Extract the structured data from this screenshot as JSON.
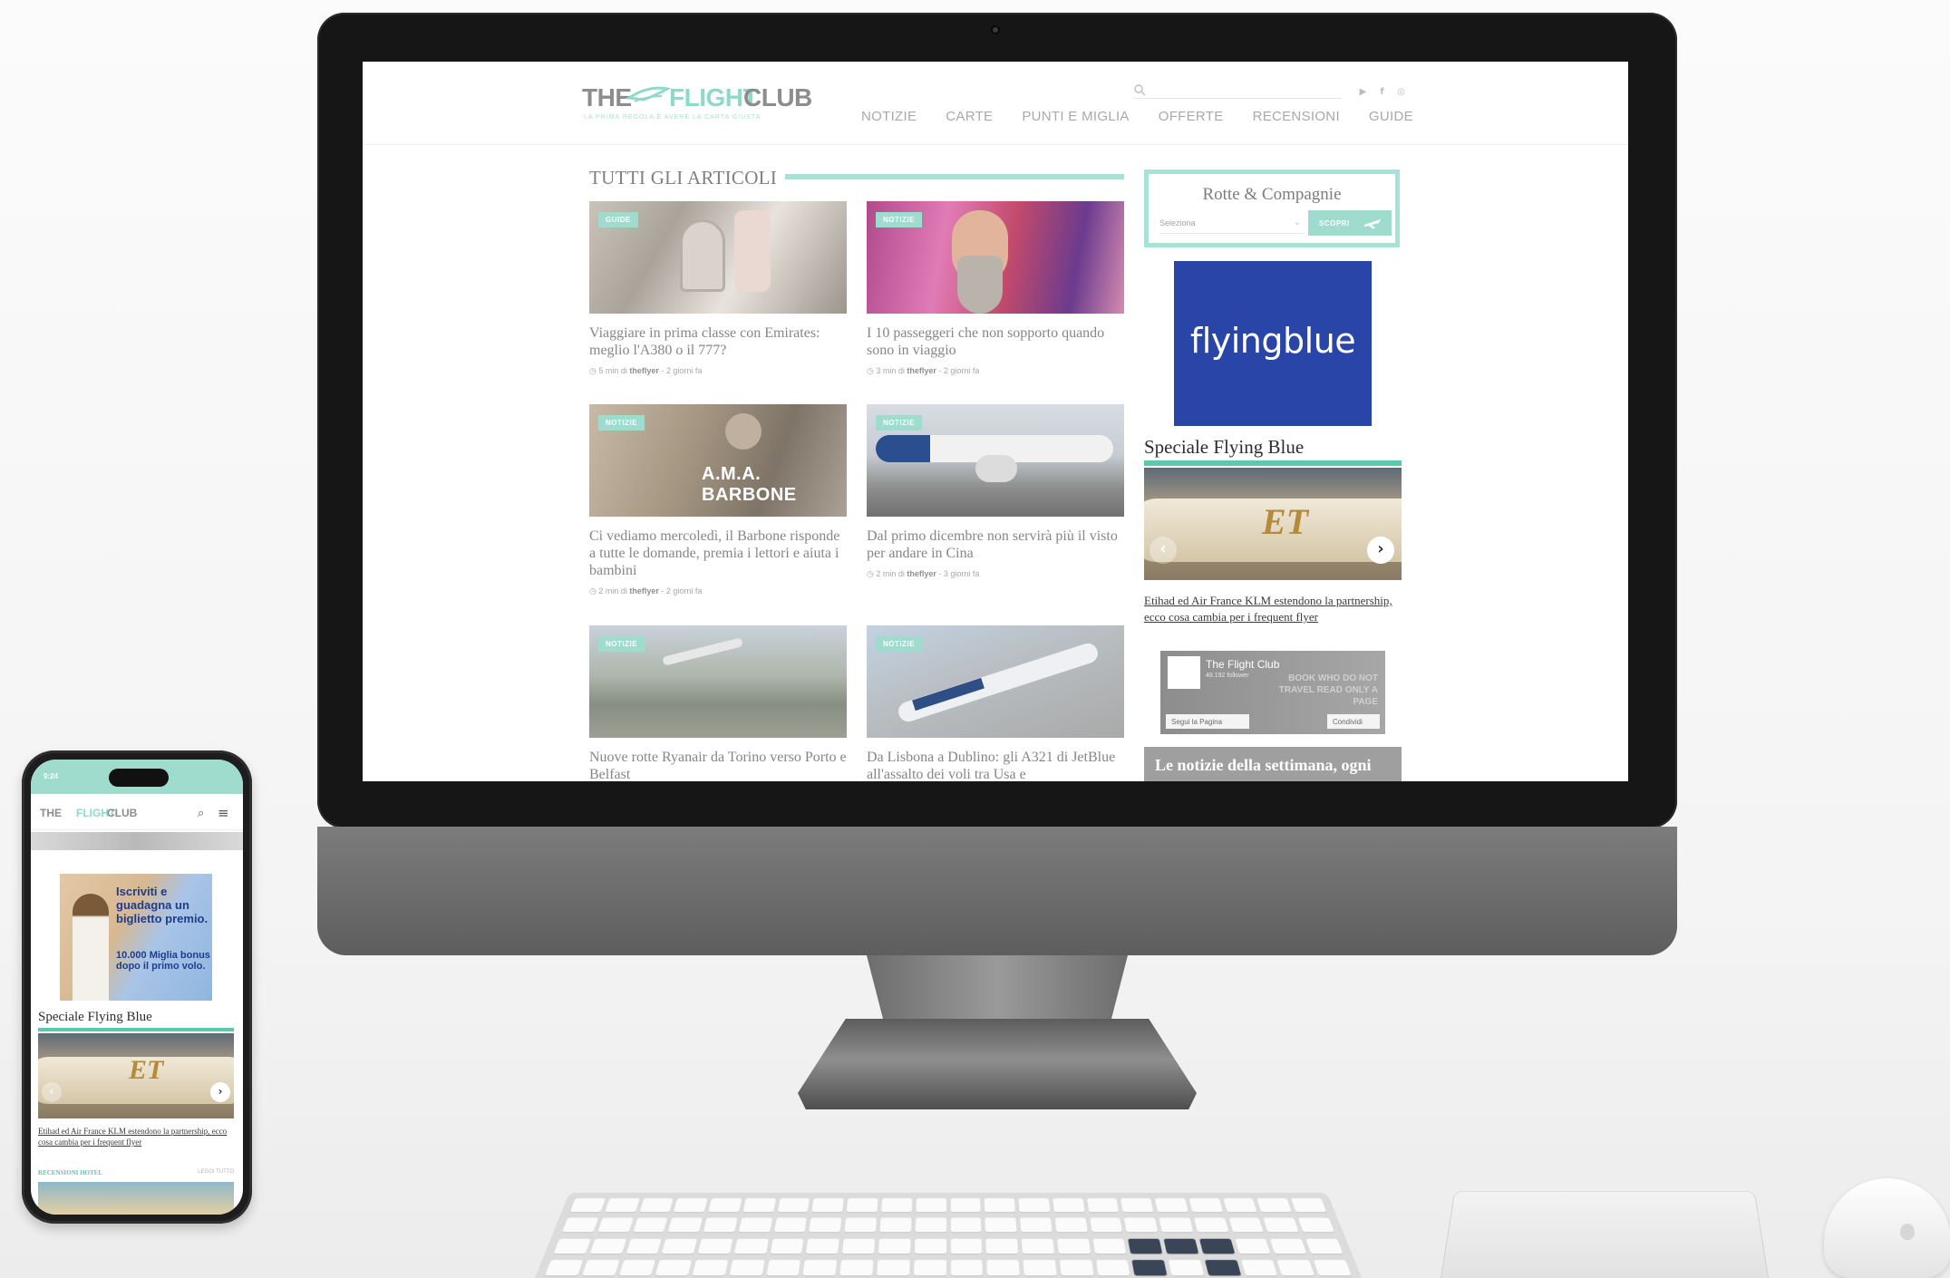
{
  "site": {
    "logo_the": "THE",
    "logo_flight": "FLIGHT",
    "logo_club": "CLUB",
    "tagline": "LA PRIMA REGOLA È AVERE LA CARTA GIUSTA",
    "nav": [
      "NOTIZIE",
      "CARTE",
      "PUNTI E MIGLIA",
      "OFFERTE",
      "RECENSIONI",
      "GUIDE"
    ],
    "social_icons": [
      "youtube-icon",
      "facebook-icon",
      "instagram-icon"
    ]
  },
  "articles_section": {
    "title": "TUTTI GLI ARTICOLI",
    "cards": [
      {
        "badge": "GUIDE",
        "title": "Viaggiare in prima classe con Emirates: meglio l'A380 o il 777?",
        "meta_prefix": "5 min di ",
        "author": "theflyer",
        "meta_suffix": " - 2 giorni fa"
      },
      {
        "badge": "NOTIZIE",
        "title": "I 10 passeggeri che non sopporto quando sono in viaggio",
        "meta_prefix": "3 min di ",
        "author": "theflyer",
        "meta_suffix": " - 2 giorni fa"
      },
      {
        "badge": "NOTIZIE",
        "title": "Ci vediamo mercoledì, il Barbone risponde a tutte le domande, premia i lettori e aiuta i bambini",
        "meta_prefix": "2 min di ",
        "author": "theflyer",
        "meta_suffix": " - 2 giorni fa",
        "image_text": "A.M.A. BARBONE"
      },
      {
        "badge": "NOTIZIE",
        "title": "Dal primo dicembre non servirà più il visto per andare in Cina",
        "meta_prefix": "2 min di ",
        "author": "theflyer",
        "meta_suffix": " - 3 giorni fa"
      },
      {
        "badge": "NOTIZIE",
        "title": "Nuove rotte Ryanair da Torino verso Porto e Belfast",
        "meta_prefix": "",
        "author": "",
        "meta_suffix": ""
      },
      {
        "badge": "NOTIZIE",
        "title": "Da Lisbona a Dublino: gli A321 di JetBlue all'assalto dei voli tra Usa e",
        "meta_prefix": "",
        "author": "",
        "meta_suffix": ""
      }
    ]
  },
  "sidebar": {
    "routes_widget": {
      "title": "Rotte & Compagnie",
      "select_value": "Seleziona",
      "button_label": "SCOPRI"
    },
    "ad_text": "flyingblue",
    "special_title": "Speciale Flying Blue",
    "special_caption": "Etihad ed Air France KLM estendono la partnership, ecco cosa cambia per i frequent flyer",
    "fb": {
      "name": "The Flight Club",
      "followers": "48.192 follower",
      "overlay": "BOOK WHO DO NOT TRAVEL READ ONLY A PAGE",
      "follow": "Segui la Pagina",
      "share": "Condividi"
    },
    "news_bar": "Le notizie della settimana, ogni"
  },
  "phone": {
    "time": "9:24",
    "ad_headline": "Iscriviti e guadagna un biglietto premio.",
    "ad_sub": "10.000 Miglia bonus dopo il primo volo.",
    "special_title": "Speciale Flying Blue",
    "special_caption": "Etihad ed Air France KLM estendono la partnership, ecco cosa cambia per i frequent flyer",
    "section_label": "RECENSIONI HOTEL",
    "see_all": "LEGGI TUTTO"
  },
  "colors": {
    "accent": "#9fdccd",
    "accent_dark": "#5fc7ae",
    "flyingblue": "#2a45a8",
    "bezel": "#161616"
  }
}
